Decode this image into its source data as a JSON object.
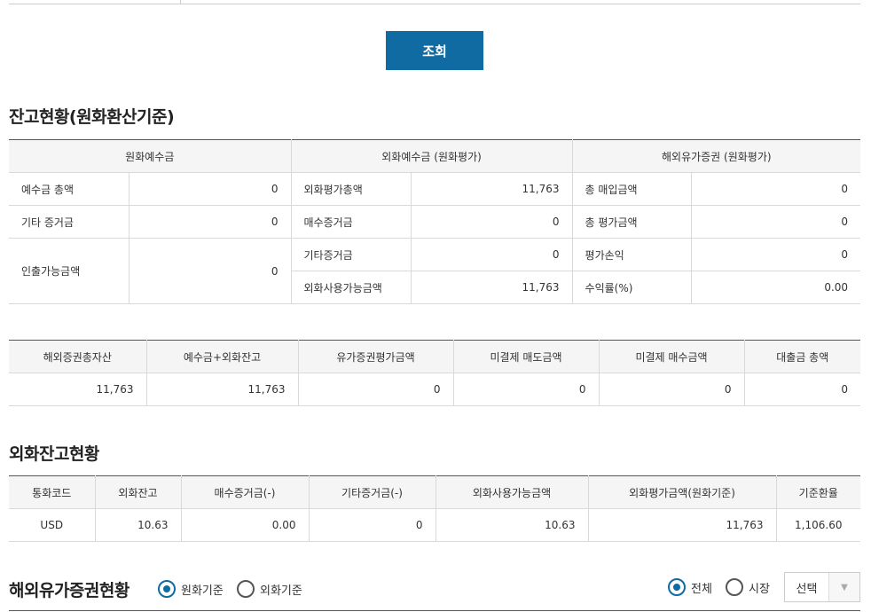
{
  "search_button": "조회",
  "balance": {
    "title": "잔고현황(원화환산기준)",
    "groups": [
      "원화예수금",
      "외화예수금 (원화평가)",
      "해외유가증권 (원화평가)"
    ],
    "krw": [
      {
        "label": "예수금 총액",
        "value": "0"
      },
      {
        "label": "기타 증거금",
        "value": "0"
      },
      {
        "label": "인출가능금액",
        "value": "0"
      }
    ],
    "fx": [
      {
        "label": "외화평가총액",
        "value": "11,763"
      },
      {
        "label": "매수증거금",
        "value": "0"
      },
      {
        "label": "기타증거금",
        "value": "0"
      },
      {
        "label": "외화사용가능금액",
        "value": "11,763"
      }
    ],
    "securities": [
      {
        "label": "총 매입금액",
        "value": "0"
      },
      {
        "label": "총 평가금액",
        "value": "0"
      },
      {
        "label": "평가손익",
        "value": "0"
      },
      {
        "label": "수익률(%)",
        "value": "0.00"
      }
    ]
  },
  "assets": {
    "headers": [
      "해외증권총자산",
      "예수금+외화잔고",
      "유가증권평가금액",
      "미결제 매도금액",
      "미결제 매수금액",
      "대출금 총액"
    ],
    "values": [
      "11,763",
      "11,763",
      "0",
      "0",
      "0",
      "0"
    ]
  },
  "fx_balance": {
    "title": "외화잔고현황",
    "headers": [
      "통화코드",
      "외화잔고",
      "매수증거금(-)",
      "기타증거금(-)",
      "외화사용가능금액",
      "외화평가금액(원화기준)",
      "기준환율"
    ],
    "rows": [
      [
        "USD",
        "10.63",
        "0.00",
        "0",
        "10.63",
        "11,763",
        "1,106.60"
      ]
    ]
  },
  "overseas": {
    "title": "해외유가증권현황",
    "basis_options": [
      {
        "label": "원화기준",
        "checked": true
      },
      {
        "label": "외화기준",
        "checked": false
      }
    ],
    "market_options": [
      {
        "label": "전체",
        "checked": true
      },
      {
        "label": "시장",
        "checked": false
      }
    ],
    "select_label": "선택"
  },
  "colors": {
    "accent": "#0f6ba1",
    "header_bg": "#f5f5f5"
  }
}
